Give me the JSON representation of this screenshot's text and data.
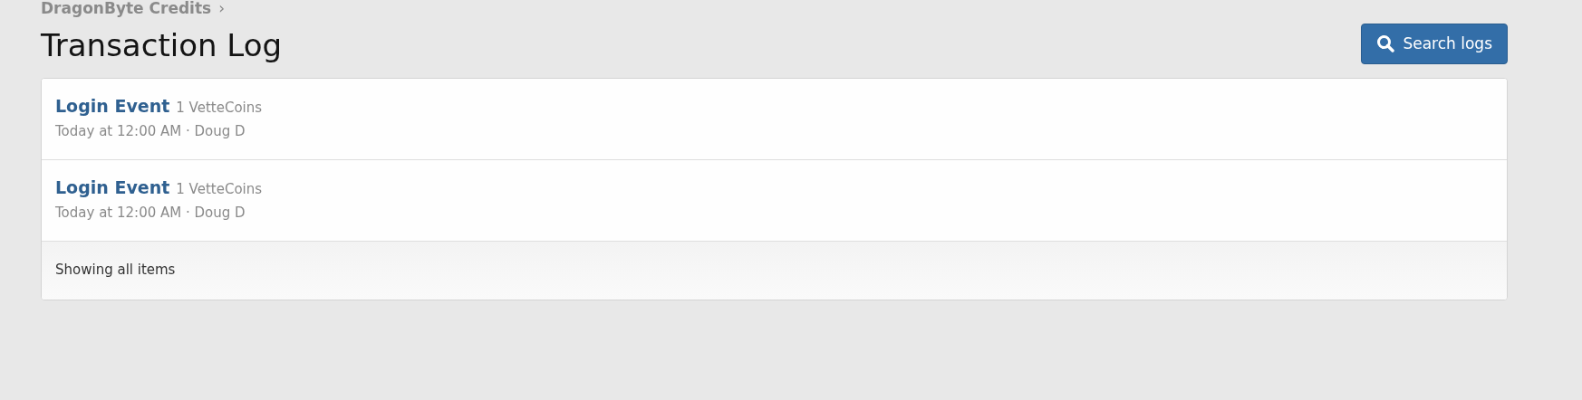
{
  "breadcrumb": {
    "label": "DragonByte Credits",
    "separator": "›"
  },
  "title": "Transaction Log",
  "search_button": {
    "label": "Search logs"
  },
  "entries": [
    {
      "event": "Login Event",
      "amount": "1 VetteCoins",
      "meta": "Today at 12:00 AM · Doug D"
    },
    {
      "event": "Login Event",
      "amount": "1 VetteCoins",
      "meta": "Today at 12:00 AM · Doug D"
    }
  ],
  "footer": "Showing all items"
}
